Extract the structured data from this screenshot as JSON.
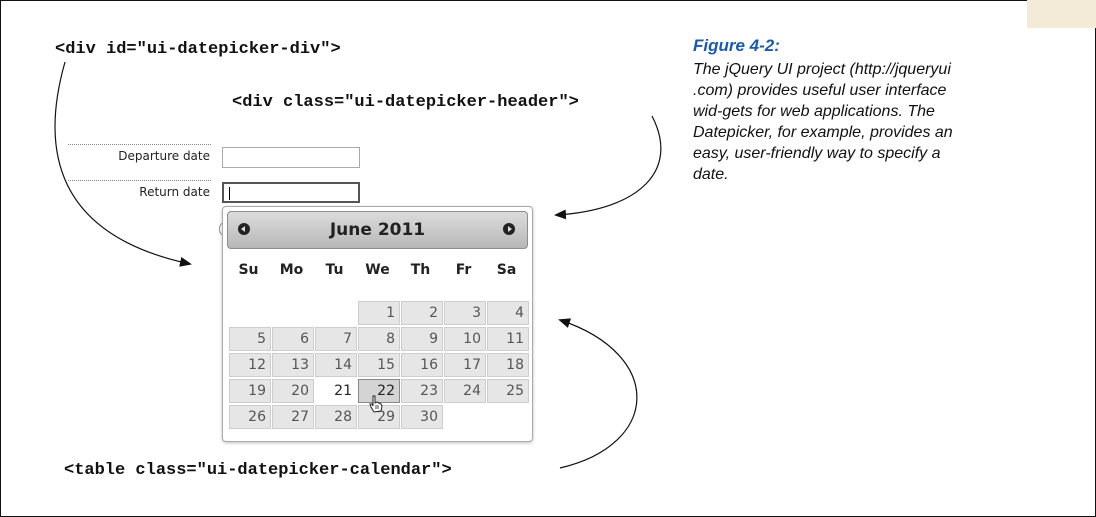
{
  "code": {
    "div_label": "<div id=\"ui-datepicker-div\">",
    "header_label": "<div class=\"ui-datepicker-header\">",
    "table_label": "<table class=\"ui-datepicker-calendar\">"
  },
  "figure": {
    "title": "Figure 4-2:",
    "caption": "The jQuery UI project (http://jqueryui .com) provides useful user interface wid-gets for web applications. The Datepicker, for example, provides an easy, user-friendly way to specify a date."
  },
  "form": {
    "departure_label": "Departure date",
    "departure_value": "",
    "return_label": "Return date",
    "return_value": ""
  },
  "datepicker": {
    "title": "June 2011",
    "prev_icon": "circle-left-arrow-icon",
    "next_icon": "circle-right-arrow-icon",
    "weekdays": [
      "Su",
      "Mo",
      "Tu",
      "We",
      "Th",
      "Fr",
      "Sa"
    ],
    "weeks": [
      [
        "",
        "",
        "",
        "1",
        "2",
        "3",
        "4"
      ],
      [
        "5",
        "6",
        "7",
        "8",
        "9",
        "10",
        "11"
      ],
      [
        "12",
        "13",
        "14",
        "15",
        "16",
        "17",
        "18"
      ],
      [
        "19",
        "20",
        "21",
        "22",
        "23",
        "24",
        "25"
      ],
      [
        "26",
        "27",
        "28",
        "29",
        "30",
        "",
        ""
      ]
    ],
    "today": "21",
    "hovered": "22"
  },
  "colors": {
    "figure_title": "#1a5aa8",
    "corner_tab": "#f3ead8"
  }
}
